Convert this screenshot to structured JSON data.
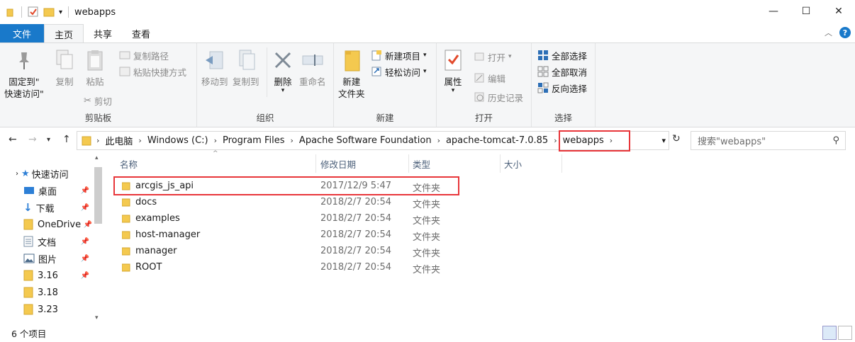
{
  "window": {
    "title": "webapps",
    "controls": [
      "minimize",
      "maximize",
      "close"
    ]
  },
  "tabs": [
    "文件",
    "主页",
    "共享",
    "查看"
  ],
  "ribbon": {
    "clipboard": {
      "label": "剪贴板",
      "pin_line1": "固定到\"",
      "pin_line2": "快速访问\"",
      "copy": "复制",
      "paste": "粘贴",
      "copy_path": "复制路径",
      "paste_shortcut": "粘贴快捷方式",
      "cut": "剪切"
    },
    "organize": {
      "label": "组织",
      "move_to": "移动到",
      "copy_to": "复制到",
      "delete": "删除",
      "rename": "重命名"
    },
    "new": {
      "label": "新建",
      "new_folder_line1": "新建",
      "new_folder_line2": "文件夹",
      "new_item": "新建项目",
      "easy_access": "轻松访问"
    },
    "open": {
      "label": "打开",
      "properties": "属性",
      "open": "打开",
      "edit": "编辑",
      "history": "历史记录"
    },
    "select": {
      "label": "选择",
      "select_all": "全部选择",
      "select_none": "全部取消",
      "invert": "反向选择"
    }
  },
  "address": {
    "crumbs": [
      "此电脑",
      "Windows (C:)",
      "Program Files",
      "Apache Software Foundation",
      "apache-tomcat-7.0.85",
      "webapps"
    ],
    "search_placeholder": "搜索\"webapps\""
  },
  "nav": {
    "items": [
      {
        "label": "快速访问",
        "icon": "star-icon",
        "pinned": false
      },
      {
        "label": "桌面",
        "icon": "desktop-icon",
        "pinned": true
      },
      {
        "label": "下载",
        "icon": "download-icon",
        "pinned": true
      },
      {
        "label": "OneDrive",
        "icon": "folder-icon",
        "pinned": true
      },
      {
        "label": "文档",
        "icon": "document-icon",
        "pinned": true
      },
      {
        "label": "图片",
        "icon": "picture-icon",
        "pinned": true
      },
      {
        "label": "3.16",
        "icon": "folder-icon",
        "pinned": true
      },
      {
        "label": "3.18",
        "icon": "folder-icon",
        "pinned": false
      },
      {
        "label": "3.23",
        "icon": "folder-icon",
        "pinned": false
      }
    ]
  },
  "list": {
    "columns": [
      "名称",
      "修改日期",
      "类型",
      "大小"
    ],
    "rows": [
      {
        "name": "arcgis_js_api",
        "date": "2017/12/9 5:47",
        "type": "文件夹",
        "size": ""
      },
      {
        "name": "docs",
        "date": "2018/2/7 20:54",
        "type": "文件夹",
        "size": ""
      },
      {
        "name": "examples",
        "date": "2018/2/7 20:54",
        "type": "文件夹",
        "size": ""
      },
      {
        "name": "host-manager",
        "date": "2018/2/7 20:54",
        "type": "文件夹",
        "size": ""
      },
      {
        "name": "manager",
        "date": "2018/2/7 20:54",
        "type": "文件夹",
        "size": ""
      },
      {
        "name": "ROOT",
        "date": "2018/2/7 20:54",
        "type": "文件夹",
        "size": ""
      }
    ]
  },
  "status": {
    "count": "6 个项目"
  },
  "colors": {
    "accent": "#1979ca",
    "highlight": "#e8363a",
    "folder": "#f4c94f"
  }
}
